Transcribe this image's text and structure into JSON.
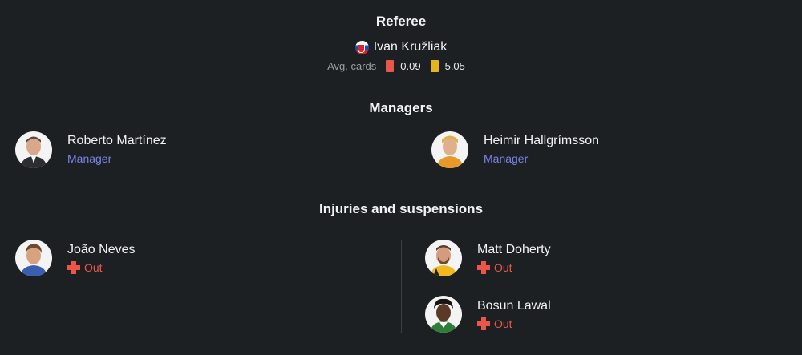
{
  "referee": {
    "title": "Referee",
    "name": "Ivan Kružliak",
    "flag_icon": "slovakia-flag",
    "avg_cards_label": "Avg. cards",
    "red_cards": "0.09",
    "yellow_cards": "5.05",
    "red_color": "#e8574a",
    "yellow_color": "#e4b51d"
  },
  "managers": {
    "title": "Managers",
    "items": [
      {
        "name": "Roberto Martínez",
        "role": "Manager"
      },
      {
        "name": "Heimir Hallgrímsson",
        "role": "Manager"
      }
    ]
  },
  "injuries": {
    "title": "Injuries and suspensions",
    "home": [
      {
        "name": "João Neves",
        "status": "Out"
      }
    ],
    "away": [
      {
        "name": "Matt Doherty",
        "status": "Out"
      },
      {
        "name": "Bosun Lawal",
        "status": "Out"
      }
    ]
  },
  "colors": {
    "background": "#1d2022",
    "role_accent": "#7b83e8",
    "status_out": "#e8574a"
  }
}
